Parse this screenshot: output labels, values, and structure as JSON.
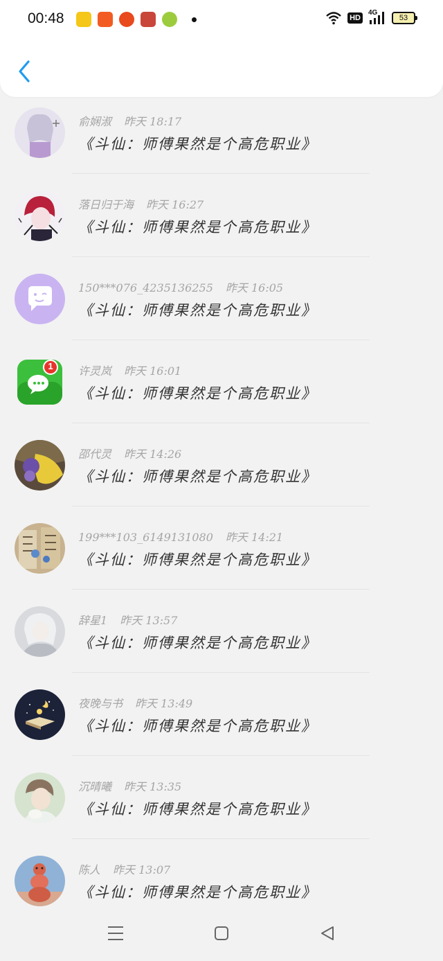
{
  "status_bar": {
    "time": "00:48",
    "network": "4G",
    "hd": "HD",
    "battery": "53",
    "app_icons": [
      "#f4c718",
      "#f25c22",
      "#e8491d",
      "#c9463b",
      "#9ccc3e"
    ]
  },
  "header": {
    "back_icon": "chevron-left-icon",
    "accent": "#1e9bf0"
  },
  "messages": [
    {
      "name": "俞娴淑",
      "time": "昨天 18:17",
      "text": "《斗仙：师傅果然是个高危职业》"
    },
    {
      "name": "落日归于海",
      "time": "昨天 16:27",
      "text": "《斗仙：师傅果然是个高危职业》"
    },
    {
      "name": "150***076_4235136255",
      "time": "昨天 16:05",
      "text": "《斗仙：师傅果然是个高危职业》"
    },
    {
      "name": "许灵岚",
      "time": "昨天 16:01",
      "text": "《斗仙：师傅果然是个高危职业》",
      "badge": "1"
    },
    {
      "name": "邵代灵",
      "time": "昨天 14:26",
      "text": "《斗仙：师傅果然是个高危职业》"
    },
    {
      "name": "199***103_6149131080",
      "time": "昨天 14:21",
      "text": "《斗仙：师傅果然是个高危职业》"
    },
    {
      "name": "辞星1",
      "time": "昨天 13:57",
      "text": "《斗仙：师傅果然是个高危职业》"
    },
    {
      "name": "夜晚与书",
      "time": "昨天 13:49",
      "text": "《斗仙：师傅果然是个高危职业》"
    },
    {
      "name": "沉晴曦",
      "time": "昨天 13:35",
      "text": "《斗仙：师傅果然是个高危职业》"
    },
    {
      "name": "陈人",
      "time": "昨天 13:07",
      "text": "《斗仙：师傅果然是个高危职业》"
    }
  ],
  "nav": {
    "menu_icon": "menu-icon",
    "home_icon": "home-square-icon",
    "back_icon": "back-triangle-icon"
  }
}
